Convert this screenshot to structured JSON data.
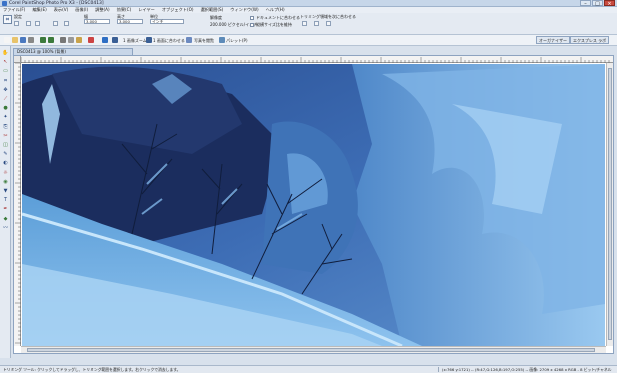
{
  "window": {
    "title": "Corel PaintShop Photo Pro X3 - [DSC0413]"
  },
  "menu": [
    "ファイル(F)",
    "編集(E)",
    "表示(V)",
    "画像(I)",
    "調整(A)",
    "効果(C)",
    "レイヤー",
    "オブジェクト(O)",
    "選択範囲(S)",
    "ウィンドウ(W)",
    "ヘルプ(H)"
  ],
  "tool_options": {
    "preset_label": "設定",
    "width_label": "幅",
    "width_value": "3.000",
    "height_label": "高さ",
    "height_value": "3.000",
    "unit_label": "単位",
    "unit_value": "インチ",
    "resolution_label": "解像度",
    "resolution_value": "200.000 ピクセル/インチ",
    "check_fit": "ドキュメントに合わせる",
    "check_aspect": "縦横サイズ比を維持",
    "snap_label": "トリミング領域を次に合わせる"
  },
  "toolbar": {
    "zoom_in_label": "1 画像ズーム",
    "zoom_fit_label": "1 画面に合わせる",
    "palette_label": "写真を閲覧",
    "palette2_label": "パレット(P)",
    "organizer_tab": "オーガナイザー",
    "express_tab": "エクスプレス ラボ"
  },
  "document": {
    "tab_label": "DSC0413 @ 100% (背景)"
  },
  "status": {
    "help": "トリミング ツール: クリックしてドラッグし、トリミング範囲を選択します。右クリックで消去します。",
    "coords": "(x:766 y:1721) -- (R:47,G:126,B:197,O:255) -- 画像: 2709 x 4268 x RGB - 8 ビット/チャネル"
  },
  "colors": {
    "accent": "#3a72c8",
    "snow_light": "#9fc8ec",
    "snow_dark": "#1c3266"
  }
}
